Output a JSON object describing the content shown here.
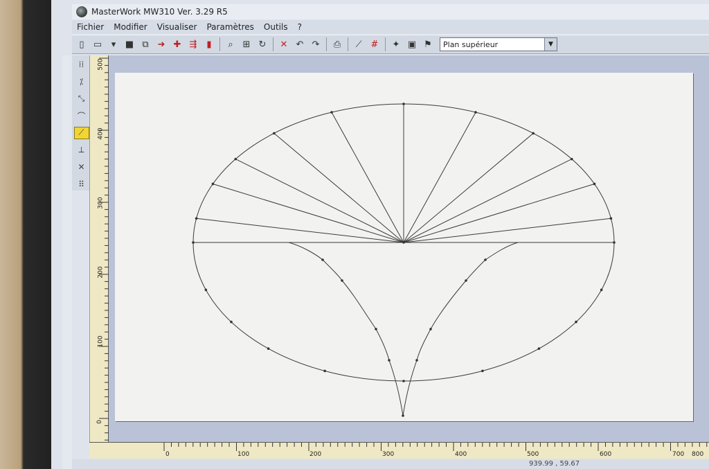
{
  "window": {
    "title": "MasterWork MW310 Ver. 3.29 R5"
  },
  "menu": [
    "Fichier",
    "Modifier",
    "Visualiser",
    "Paramètres",
    "Outils",
    "?"
  ],
  "toolbar": {
    "view_select_value": "Plan supérieur"
  },
  "rulers": {
    "vertical_labels": [
      "500",
      "400",
      "300",
      "200",
      "100",
      "0"
    ],
    "horizontal_labels": [
      "0",
      "100",
      "200",
      "300",
      "400",
      "500",
      "600",
      "700",
      "800"
    ]
  },
  "status": {
    "coords": "939.99 , 59.67"
  }
}
